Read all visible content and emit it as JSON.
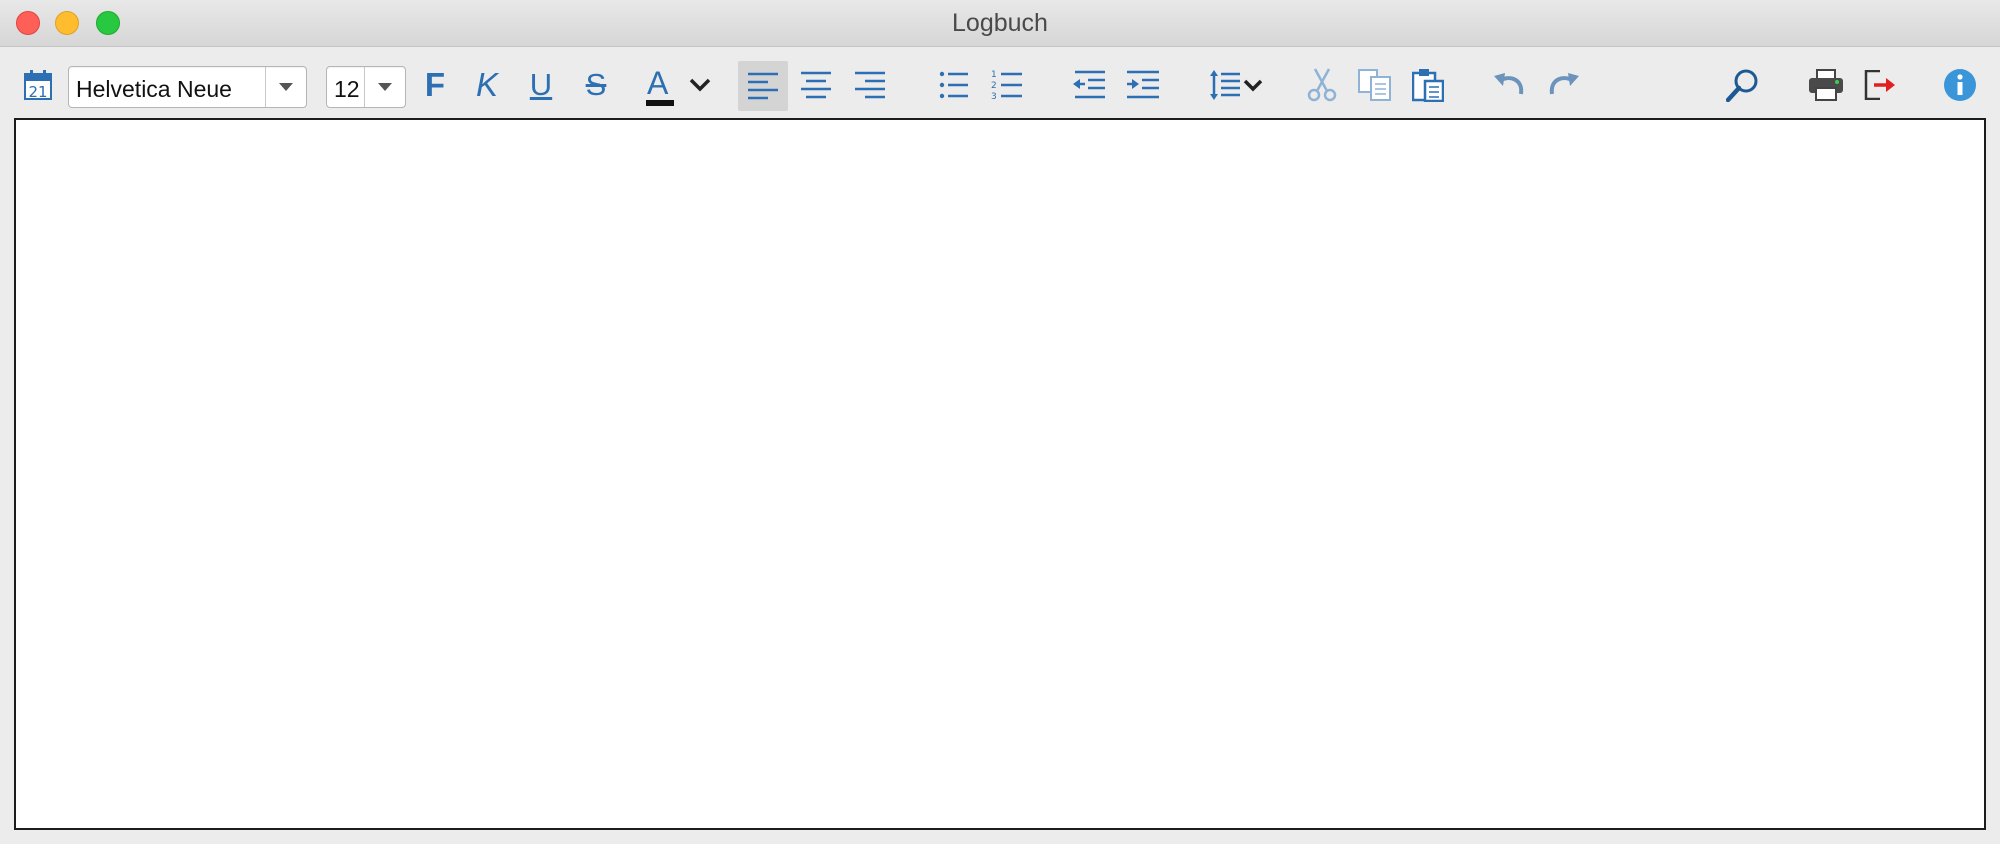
{
  "window": {
    "title": "Logbuch"
  },
  "toolbar": {
    "font_family": "Helvetica Neue",
    "font_size": "12",
    "bold_label": "F",
    "italic_label": "K",
    "underline_label": "U",
    "strike_label": "S",
    "color_label": "A"
  },
  "editor": {
    "content": ""
  },
  "colors": {
    "accent": "#2c6fb3",
    "icon_light": "#8fb3d6",
    "close": "#fe5f57",
    "minimize": "#febc2e",
    "maximize": "#28c840"
  }
}
